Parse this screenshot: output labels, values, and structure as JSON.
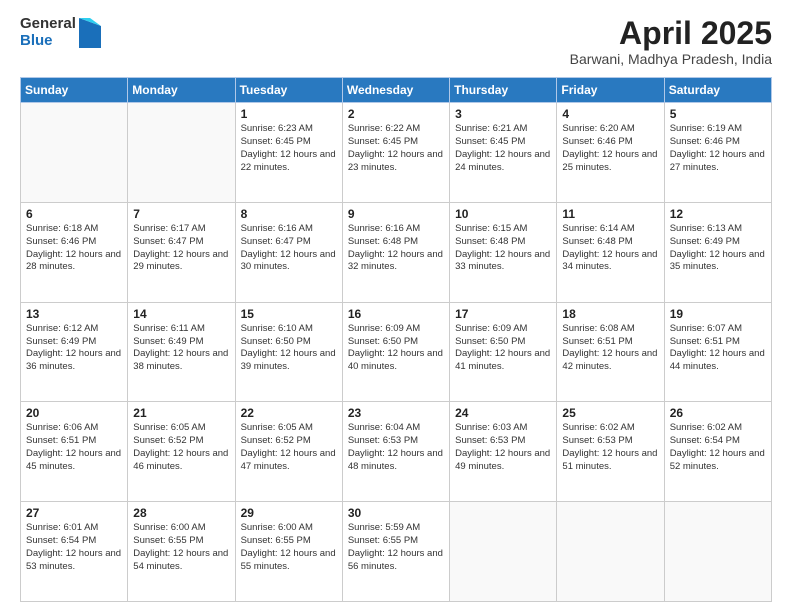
{
  "header": {
    "logo_general": "General",
    "logo_blue": "Blue",
    "month_title": "April 2025",
    "subtitle": "Barwani, Madhya Pradesh, India"
  },
  "weekdays": [
    "Sunday",
    "Monday",
    "Tuesday",
    "Wednesday",
    "Thursday",
    "Friday",
    "Saturday"
  ],
  "rows": [
    [
      {
        "day": "",
        "sunrise": "",
        "sunset": "",
        "daylight": "",
        "empty": true
      },
      {
        "day": "",
        "sunrise": "",
        "sunset": "",
        "daylight": "",
        "empty": true
      },
      {
        "day": "1",
        "sunrise": "Sunrise: 6:23 AM",
        "sunset": "Sunset: 6:45 PM",
        "daylight": "Daylight: 12 hours and 22 minutes."
      },
      {
        "day": "2",
        "sunrise": "Sunrise: 6:22 AM",
        "sunset": "Sunset: 6:45 PM",
        "daylight": "Daylight: 12 hours and 23 minutes."
      },
      {
        "day": "3",
        "sunrise": "Sunrise: 6:21 AM",
        "sunset": "Sunset: 6:45 PM",
        "daylight": "Daylight: 12 hours and 24 minutes."
      },
      {
        "day": "4",
        "sunrise": "Sunrise: 6:20 AM",
        "sunset": "Sunset: 6:46 PM",
        "daylight": "Daylight: 12 hours and 25 minutes."
      },
      {
        "day": "5",
        "sunrise": "Sunrise: 6:19 AM",
        "sunset": "Sunset: 6:46 PM",
        "daylight": "Daylight: 12 hours and 27 minutes."
      }
    ],
    [
      {
        "day": "6",
        "sunrise": "Sunrise: 6:18 AM",
        "sunset": "Sunset: 6:46 PM",
        "daylight": "Daylight: 12 hours and 28 minutes."
      },
      {
        "day": "7",
        "sunrise": "Sunrise: 6:17 AM",
        "sunset": "Sunset: 6:47 PM",
        "daylight": "Daylight: 12 hours and 29 minutes."
      },
      {
        "day": "8",
        "sunrise": "Sunrise: 6:16 AM",
        "sunset": "Sunset: 6:47 PM",
        "daylight": "Daylight: 12 hours and 30 minutes."
      },
      {
        "day": "9",
        "sunrise": "Sunrise: 6:16 AM",
        "sunset": "Sunset: 6:48 PM",
        "daylight": "Daylight: 12 hours and 32 minutes."
      },
      {
        "day": "10",
        "sunrise": "Sunrise: 6:15 AM",
        "sunset": "Sunset: 6:48 PM",
        "daylight": "Daylight: 12 hours and 33 minutes."
      },
      {
        "day": "11",
        "sunrise": "Sunrise: 6:14 AM",
        "sunset": "Sunset: 6:48 PM",
        "daylight": "Daylight: 12 hours and 34 minutes."
      },
      {
        "day": "12",
        "sunrise": "Sunrise: 6:13 AM",
        "sunset": "Sunset: 6:49 PM",
        "daylight": "Daylight: 12 hours and 35 minutes."
      }
    ],
    [
      {
        "day": "13",
        "sunrise": "Sunrise: 6:12 AM",
        "sunset": "Sunset: 6:49 PM",
        "daylight": "Daylight: 12 hours and 36 minutes."
      },
      {
        "day": "14",
        "sunrise": "Sunrise: 6:11 AM",
        "sunset": "Sunset: 6:49 PM",
        "daylight": "Daylight: 12 hours and 38 minutes."
      },
      {
        "day": "15",
        "sunrise": "Sunrise: 6:10 AM",
        "sunset": "Sunset: 6:50 PM",
        "daylight": "Daylight: 12 hours and 39 minutes."
      },
      {
        "day": "16",
        "sunrise": "Sunrise: 6:09 AM",
        "sunset": "Sunset: 6:50 PM",
        "daylight": "Daylight: 12 hours and 40 minutes."
      },
      {
        "day": "17",
        "sunrise": "Sunrise: 6:09 AM",
        "sunset": "Sunset: 6:50 PM",
        "daylight": "Daylight: 12 hours and 41 minutes."
      },
      {
        "day": "18",
        "sunrise": "Sunrise: 6:08 AM",
        "sunset": "Sunset: 6:51 PM",
        "daylight": "Daylight: 12 hours and 42 minutes."
      },
      {
        "day": "19",
        "sunrise": "Sunrise: 6:07 AM",
        "sunset": "Sunset: 6:51 PM",
        "daylight": "Daylight: 12 hours and 44 minutes."
      }
    ],
    [
      {
        "day": "20",
        "sunrise": "Sunrise: 6:06 AM",
        "sunset": "Sunset: 6:51 PM",
        "daylight": "Daylight: 12 hours and 45 minutes."
      },
      {
        "day": "21",
        "sunrise": "Sunrise: 6:05 AM",
        "sunset": "Sunset: 6:52 PM",
        "daylight": "Daylight: 12 hours and 46 minutes."
      },
      {
        "day": "22",
        "sunrise": "Sunrise: 6:05 AM",
        "sunset": "Sunset: 6:52 PM",
        "daylight": "Daylight: 12 hours and 47 minutes."
      },
      {
        "day": "23",
        "sunrise": "Sunrise: 6:04 AM",
        "sunset": "Sunset: 6:53 PM",
        "daylight": "Daylight: 12 hours and 48 minutes."
      },
      {
        "day": "24",
        "sunrise": "Sunrise: 6:03 AM",
        "sunset": "Sunset: 6:53 PM",
        "daylight": "Daylight: 12 hours and 49 minutes."
      },
      {
        "day": "25",
        "sunrise": "Sunrise: 6:02 AM",
        "sunset": "Sunset: 6:53 PM",
        "daylight": "Daylight: 12 hours and 51 minutes."
      },
      {
        "day": "26",
        "sunrise": "Sunrise: 6:02 AM",
        "sunset": "Sunset: 6:54 PM",
        "daylight": "Daylight: 12 hours and 52 minutes."
      }
    ],
    [
      {
        "day": "27",
        "sunrise": "Sunrise: 6:01 AM",
        "sunset": "Sunset: 6:54 PM",
        "daylight": "Daylight: 12 hours and 53 minutes."
      },
      {
        "day": "28",
        "sunrise": "Sunrise: 6:00 AM",
        "sunset": "Sunset: 6:55 PM",
        "daylight": "Daylight: 12 hours and 54 minutes."
      },
      {
        "day": "29",
        "sunrise": "Sunrise: 6:00 AM",
        "sunset": "Sunset: 6:55 PM",
        "daylight": "Daylight: 12 hours and 55 minutes."
      },
      {
        "day": "30",
        "sunrise": "Sunrise: 5:59 AM",
        "sunset": "Sunset: 6:55 PM",
        "daylight": "Daylight: 12 hours and 56 minutes."
      },
      {
        "day": "",
        "sunrise": "",
        "sunset": "",
        "daylight": "",
        "empty": true
      },
      {
        "day": "",
        "sunrise": "",
        "sunset": "",
        "daylight": "",
        "empty": true
      },
      {
        "day": "",
        "sunrise": "",
        "sunset": "",
        "daylight": "",
        "empty": true
      }
    ]
  ]
}
